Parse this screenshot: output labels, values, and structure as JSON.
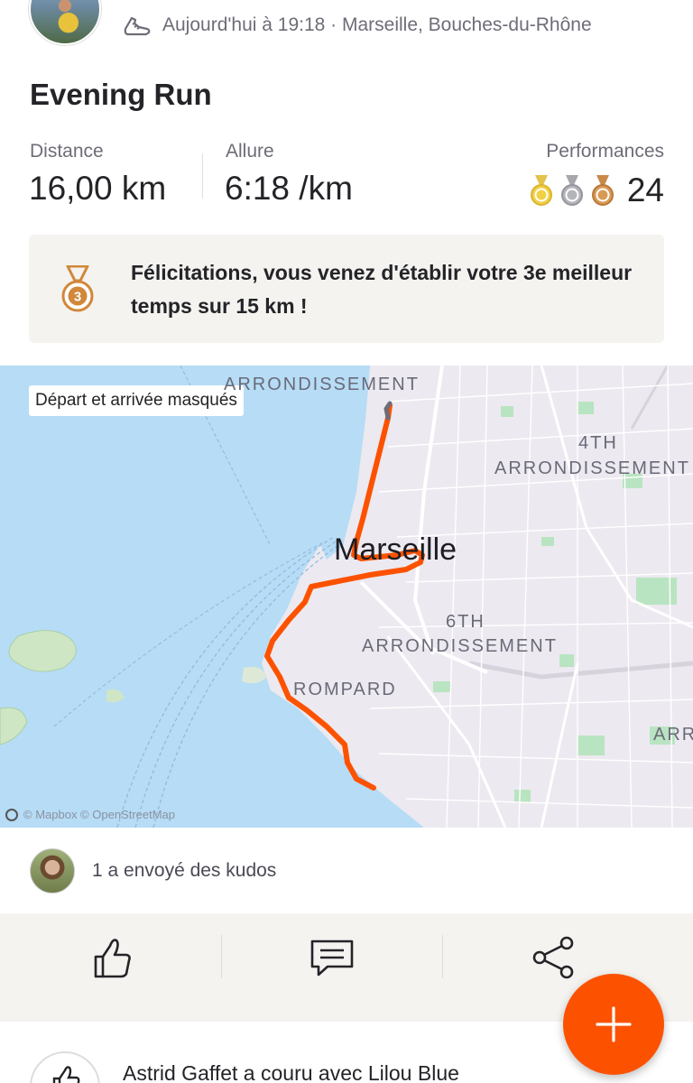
{
  "header": {
    "meta": "Aujourd'hui à 19:18 · Marseille, Bouches-du-Rhône",
    "activity_icon": "running-shoe-icon"
  },
  "activity": {
    "title": "Evening Run",
    "stats": {
      "distance_label": "Distance",
      "distance_value": "16,00 km",
      "pace_label": "Allure",
      "pace_value": "6:18 /km",
      "performances_label": "Performances",
      "performances_count": "24",
      "medals": [
        "gold",
        "silver",
        "bronze"
      ]
    },
    "achievement": {
      "icon": "bronze-medal-3-icon",
      "text": "Félicitations, vous venez d'établir votre 3e meilleur temps sur 15 km !"
    }
  },
  "map": {
    "badge": "Départ et arrivée masqués",
    "city": "Marseille",
    "labels": {
      "arr_top": "ARRONDISSEMENT",
      "arr4_num": "4TH",
      "arr4": "ARRONDISSEMENT",
      "arr6_num": "6TH",
      "arr6": "ARRONDISSEMENT",
      "district": "ROMPARD",
      "edge": "ARR"
    },
    "attribution": "© Mapbox © OpenStreetMap",
    "colors": {
      "water": "#b6dcf6",
      "land": "#ece9f0",
      "park": "#b9e4c1",
      "route": "#fc5200"
    }
  },
  "kudos": {
    "text": "1 a envoyé des kudos"
  },
  "actions": [
    "kudos-thumb-icon",
    "comment-icon",
    "share-icon"
  ],
  "feed": {
    "text": "Astrid Gaffet a couru avec Lilou Blue"
  },
  "fab": {
    "icon": "plus-icon",
    "color": "#fc5200"
  }
}
